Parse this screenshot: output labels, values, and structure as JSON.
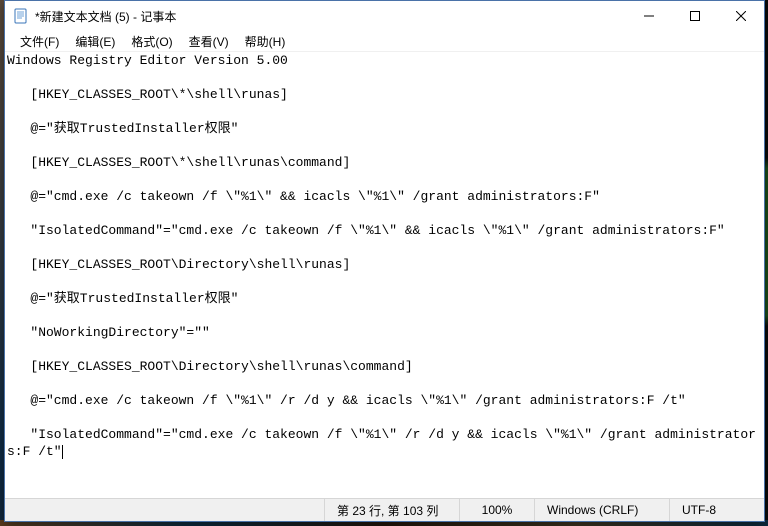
{
  "window": {
    "title": "*新建文本文档 (5) - 记事本"
  },
  "menu": {
    "file": "文件(F)",
    "edit": "编辑(E)",
    "format": "格式(O)",
    "view": "查看(V)",
    "help": "帮助(H)"
  },
  "editor": {
    "content": "Windows Registry Editor Version 5.00\n\n   [HKEY_CLASSES_ROOT\\*\\shell\\runas]\n\n   @=\"获取TrustedInstaller权限\"\n\n   [HKEY_CLASSES_ROOT\\*\\shell\\runas\\command]\n\n   @=\"cmd.exe /c takeown /f \\\"%1\\\" && icacls \\\"%1\\\" /grant administrators:F\"\n\n   \"IsolatedCommand\"=\"cmd.exe /c takeown /f \\\"%1\\\" && icacls \\\"%1\\\" /grant administrators:F\"\n\n   [HKEY_CLASSES_ROOT\\Directory\\shell\\runas]\n\n   @=\"获取TrustedInstaller权限\"\n\n   \"NoWorkingDirectory\"=\"\"\n\n   [HKEY_CLASSES_ROOT\\Directory\\shell\\runas\\command]\n\n   @=\"cmd.exe /c takeown /f \\\"%1\\\" /r /d y && icacls \\\"%1\\\" /grant administrators:F /t\"\n\n   \"IsolatedCommand\"=\"cmd.exe /c takeown /f \\\"%1\\\" /r /d y && icacls \\\"%1\\\" /grant administrators:F /t\""
  },
  "status": {
    "position": "第 23 行, 第 103 列",
    "zoom": "100%",
    "eol": "Windows (CRLF)",
    "encoding": "UTF-8"
  }
}
